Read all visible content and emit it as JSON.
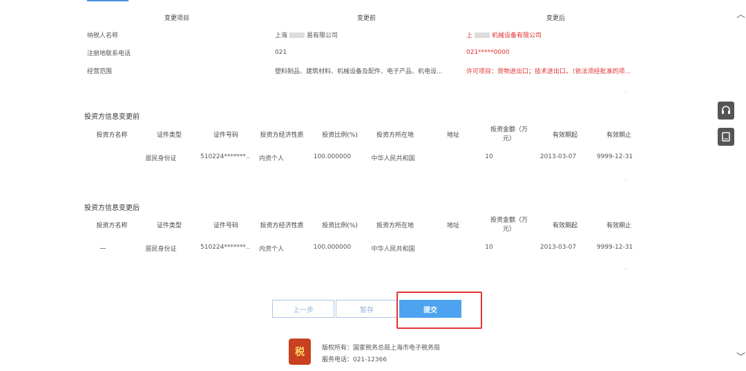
{
  "change_table": {
    "headers": [
      "变更项目",
      "变更前",
      "变更后"
    ],
    "rows": [
      {
        "item": "纳税人名称",
        "before": "上海",
        "before_suffix": "易有限公司",
        "after": "上",
        "after_suffix": "机械设备有限公司"
      },
      {
        "item": "注册地联系电话",
        "before": "021",
        "before_suffix": "",
        "after": "021*****0000",
        "after_suffix": ""
      },
      {
        "item": "经营范围",
        "before": "塑料制品、建筑材料、机械设备及配件、电子产品、机电设...",
        "before_suffix": "",
        "after": "许可项目：货物进出口；技术进出口。（依法须经批准的项...",
        "after_suffix": ""
      }
    ]
  },
  "investor_before": {
    "title": "投资方信息变更前",
    "headers": [
      "投资方名称",
      "证件类型",
      "证件号码",
      "投资方经济性质",
      "投资比例(%)",
      "投资方所在地",
      "地址",
      "投资金额（万元）",
      "有效期起",
      "有效期止"
    ],
    "row": [
      "",
      "居民身份证",
      "510224*******...",
      "内资个人",
      "100.000000",
      "中华人民共和国",
      "",
      "10",
      "2013-03-07",
      "9999-12-31"
    ]
  },
  "investor_after": {
    "title": "投资方信息变更后",
    "headers": [
      "投资方名称",
      "证件类型",
      "证件号码",
      "投资方经济性质",
      "投资比例(%)",
      "投资方所在地",
      "地址",
      "投资金额（万元）",
      "有效期起",
      "有效期止"
    ],
    "row": [
      "一",
      "居民身份证",
      "510224*******...",
      "内资个人",
      "100.000000",
      "中华人民共和国",
      "",
      "10",
      "2013-03-07",
      "9999-12-31"
    ]
  },
  "buttons": {
    "prev": "上一步",
    "save": "暂存",
    "submit": "提交"
  },
  "footer": {
    "logo_text": "税",
    "copyright": "版权所有：国家税务总局上海市电子税务局",
    "phone": "服务电话：021-12366"
  },
  "side": {
    "service_icon": "headset-icon",
    "manual_icon": "book-icon"
  },
  "colors": {
    "accent": "#4da3f0",
    "highlight": "#e53232",
    "changed_text": "#e03030"
  }
}
